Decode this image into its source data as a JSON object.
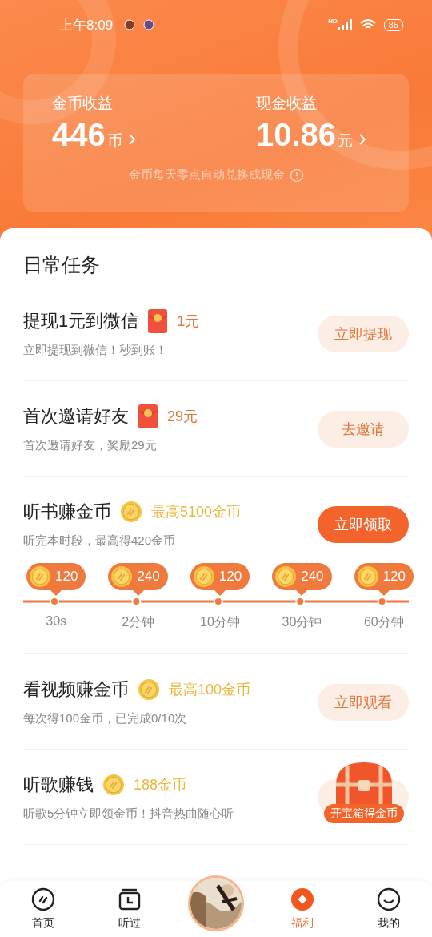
{
  "status_bar": {
    "time": "上午8:09",
    "network": "HD",
    "battery": "85"
  },
  "earnings": [
    {
      "label": "金币收益",
      "amount": "446",
      "unit": "币"
    },
    {
      "label": "现金收益",
      "amount": "10.86",
      "unit": "元"
    }
  ],
  "earnings_note": "金币每天零点自动兑换成现金",
  "section_title": "日常任务",
  "tasks": [
    {
      "title": "提现1元到微信",
      "reward": {
        "kind": "envelope",
        "text": "1元"
      },
      "subtitle": "立即提现到微信！秒到账！",
      "button": {
        "label": "立即提现",
        "kind": "light"
      }
    },
    {
      "title": "首次邀请好友",
      "reward": {
        "kind": "envelope",
        "text": "29元"
      },
      "subtitle": "首次邀请好友，奖励29元",
      "button": {
        "label": "去邀请",
        "kind": "light"
      }
    },
    {
      "title": "听书赚金币",
      "reward": {
        "kind": "coin",
        "text": "最高5100金币"
      },
      "subtitle": "听完本时段，最高得420金币",
      "button": {
        "label": "立即领取",
        "kind": "solid"
      },
      "milestones": [
        {
          "coins": "120",
          "time": "30s"
        },
        {
          "coins": "240",
          "time": "2分钟"
        },
        {
          "coins": "120",
          "time": "10分钟"
        },
        {
          "coins": "240",
          "time": "30分钟"
        },
        {
          "coins": "120",
          "time": "60分钟"
        }
      ]
    },
    {
      "title": "看视频赚金币",
      "reward": {
        "kind": "coin",
        "text": "最高100金币"
      },
      "subtitle": "每次得100金币，已完成0/10次",
      "button": {
        "label": "立即观看",
        "kind": "light"
      }
    },
    {
      "title": "听歌赚钱",
      "reward": {
        "kind": "coin",
        "text": "188金币"
      },
      "subtitle": "听歌5分钟立即领金币！抖音热曲随心听",
      "button": {
        "kind": "light"
      },
      "chest": {
        "label": "开宝箱得金币"
      }
    }
  ],
  "nav": [
    {
      "label": "首页",
      "kind": "home",
      "selected": false
    },
    {
      "label": "听过",
      "kind": "history",
      "selected": false
    },
    {
      "kind": "picture"
    },
    {
      "label": "福利",
      "kind": "bonus",
      "selected": true
    },
    {
      "label": "我的",
      "kind": "me",
      "selected": false
    }
  ]
}
